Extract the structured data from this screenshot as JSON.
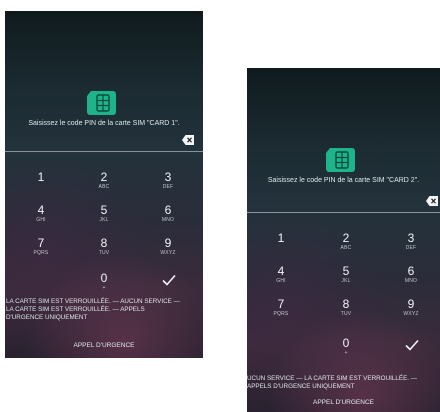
{
  "screens": [
    {
      "prompt": "Saisissez le code PIN de la carte SIM \"CARD 1\".",
      "status": "LA CARTE SIM EST VERROUILLÉE. — AUCUN SERVICE —\nLA CARTE SIM EST VERROUILLÉE. — APPELS\nD'URGENCE UNIQUEMENT",
      "emergency_label": "APPEL D'URGENCE"
    },
    {
      "prompt": "Saisissez le code PIN de la carte SIM \"CARD 2\".",
      "status": "UCUN SERVICE — LA CARTE SIM EST VERROUILLÉE. —\nAPPELS D'URGENCE UNIQUEMENT",
      "emergency_label": "APPEL D'URGENCE"
    }
  ],
  "keypad": [
    {
      "num": "1",
      "letters": ""
    },
    {
      "num": "2",
      "letters": "ABC"
    },
    {
      "num": "3",
      "letters": "DEF"
    },
    {
      "num": "4",
      "letters": "GHI"
    },
    {
      "num": "5",
      "letters": "JKL"
    },
    {
      "num": "6",
      "letters": "MNO"
    },
    {
      "num": "7",
      "letters": "PQRS"
    },
    {
      "num": "8",
      "letters": "TUV"
    },
    {
      "num": "9",
      "letters": "WXYZ"
    },
    {
      "num": "0",
      "letters": "+"
    }
  ],
  "icons": {
    "sim": "sim-card-icon",
    "backspace": "backspace-icon",
    "confirm": "checkmark-icon"
  },
  "colors": {
    "sim_icon": "#1fb38a",
    "text": "#eef2f3"
  }
}
